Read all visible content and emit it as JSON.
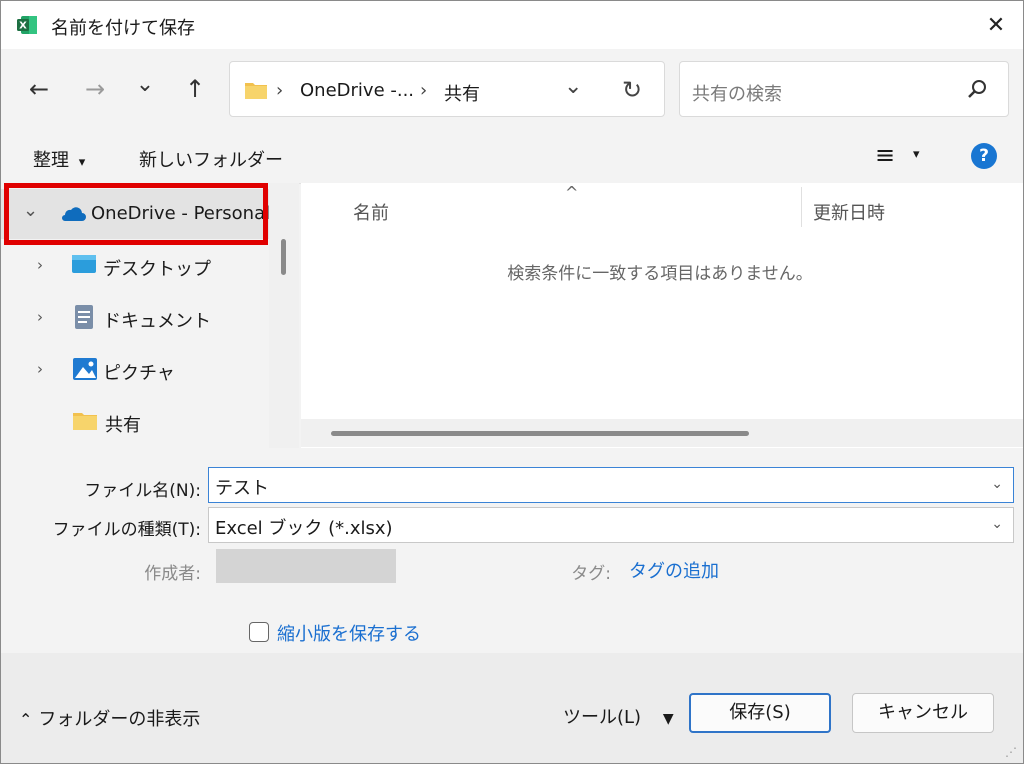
{
  "window": {
    "title": "名前を付けて保存",
    "close_glyph": "✕",
    "app_icon_letter": "X"
  },
  "nav": {
    "back_glyph": "←",
    "forward_glyph": "→",
    "recent_glyph": "⌄",
    "up_glyph": "↑"
  },
  "address": {
    "sep1": "›",
    "crumb1": "OneDrive -...",
    "sep2": "›",
    "crumb2": "共有",
    "dropdown_glyph": "⌄",
    "refresh_glyph": "↻"
  },
  "search": {
    "placeholder": "共有の検索",
    "icon_glyph": "⚲"
  },
  "toolbar": {
    "organize": "整理",
    "organize_caret": "▾",
    "new_folder": "新しいフォルダー",
    "view_glyph": "≡",
    "view_caret": "▾",
    "help_glyph": "?"
  },
  "tree": {
    "items": [
      {
        "label": "OneDrive - Personal",
        "chevron": "⌄"
      },
      {
        "label": "デスクトップ",
        "chevron": "›"
      },
      {
        "label": "ドキュメント",
        "chevron": "›"
      },
      {
        "label": "ピクチャ",
        "chevron": "›"
      },
      {
        "label": "共有",
        "chevron": ""
      }
    ]
  },
  "file_list": {
    "sort_indicator": "^",
    "col_name": "名前",
    "col_modified": "更新日時",
    "empty_message": "検索条件に一致する項目はありません。"
  },
  "form": {
    "filename_label": "ファイル名(N):",
    "filename_value": "テスト",
    "filetype_label": "ファイルの種類(T):",
    "filetype_value": "Excel ブック (*.xlsx)",
    "author_label": "作成者:",
    "tags_label": "タグ:",
    "tags_link": "タグの追加",
    "thumbnail_label": "縮小版を保存する",
    "dropdown_glyph": "⌄"
  },
  "footer": {
    "hide_folders_glyph": "⌃",
    "hide_folders": "フォルダーの非表示",
    "tools": "ツール(L)",
    "tools_caret": "▼",
    "save": "保存(S)",
    "cancel": "キャンセル"
  },
  "colors": {
    "highlight_box": "#e00000",
    "accent": "#1976d2",
    "excel_green": "#1d6f42",
    "folder_yellow": "#f2c14e",
    "onedrive_blue": "#0f6cbd"
  }
}
